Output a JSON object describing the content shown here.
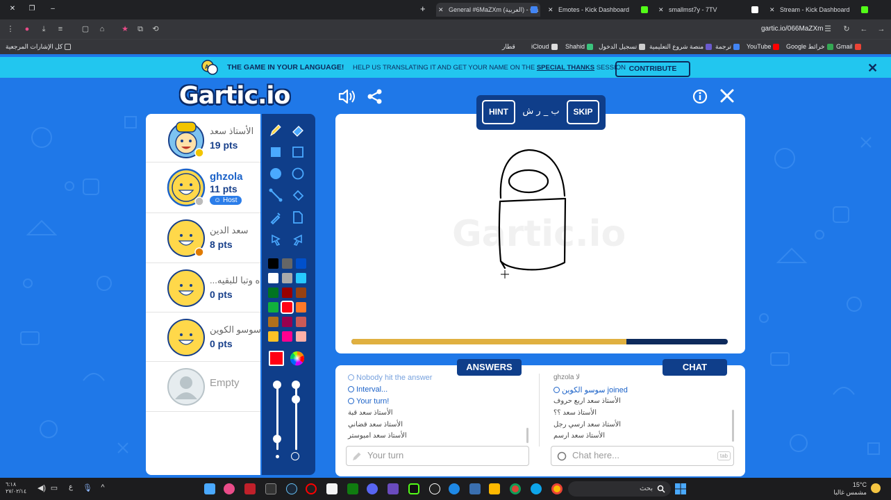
{
  "browser": {
    "tabs": [
      {
        "label": "General #6MaZXm (العربية) - Ga",
        "color": "#4285f4",
        "active": true
      },
      {
        "label": "Emotes - Kick Dashboard",
        "color": "#53fc18"
      },
      {
        "label": "smallmst7y - 7TV",
        "color": "#ffffff"
      },
      {
        "label": "Stream - Kick Dashboard",
        "color": "#53fc18"
      }
    ],
    "url": "gartic.io/066MaZXm",
    "bookmarks": [
      "Gmail",
      "Google خرائط",
      "YouTube",
      "ترجمة",
      "منصة شروع التعليمية",
      "تسجيل الدخول",
      "Shahid",
      "iCloud",
      "قطار",
      "كل الإشارات المرجعية"
    ]
  },
  "banner": {
    "headline": "THE GAME IN YOUR LANGUAGE!",
    "text_before": "HELP US TRANSLATING IT AND GET YOUR NAME ON THE",
    "link": "SPECIAL THANKS",
    "text_after": "SESSION",
    "button": "CONTRIBUTE"
  },
  "logo": "Gartic.io",
  "players": [
    {
      "name": "الأستاذ سعد",
      "points": "19 pts",
      "status_color": "#f2c500"
    },
    {
      "name": "ghzola",
      "points": "11 pts",
      "status_color": "#bbbbbb",
      "badge": "Host"
    },
    {
      "name": "سعد الدين",
      "points": "8 pts",
      "status_color": "#e07b00"
    },
    {
      "name": "...ه وتبا للبقيه",
      "points": "0 pts"
    },
    {
      "name": "سوسو الكوين",
      "points": "0 pts"
    }
  ],
  "empty_slot": "Empty",
  "palette": {
    "colors": [
      "#000000",
      "#666666",
      "#0050cc",
      "#ffffff",
      "#aaaaaa",
      "#26c9ff",
      "#017420",
      "#990000",
      "#964112",
      "#11b03c",
      "#ff0013",
      "#ff7829",
      "#b0701c",
      "#99004e",
      "#cb5a57",
      "#ffc126",
      "#ff008f",
      "#feafa8"
    ],
    "selected_color": "#ff0013"
  },
  "word_panel": {
    "hint": "HINT",
    "word": "ب _ ر ش",
    "skip": "SKIP"
  },
  "timer": {
    "progress": 0.73,
    "fill_color": "#e0b040"
  },
  "answers": {
    "tab": "ANSWERS",
    "messages": [
      {
        "text": "Nobody hit the answer",
        "type": "sys"
      },
      {
        "text": "Interval...",
        "type": "sys"
      },
      {
        "text": "Your turn!",
        "type": "sys"
      },
      {
        "text": "الأستاذ سعد قبة",
        "type": "msg"
      },
      {
        "text": "الأستاذ سعد قضاني",
        "type": "msg"
      },
      {
        "text": "الأستاذ سعد امبوستر",
        "type": "msg"
      }
    ],
    "placeholder": "Your turn"
  },
  "chat": {
    "tab": "CHAT",
    "messages": [
      {
        "text": "ghzola لا",
        "type": "msg"
      },
      {
        "text": "سوسو الكوين joined",
        "type": "sys"
      },
      {
        "text": "الأستاذ سعد اربع حروف",
        "type": "msg"
      },
      {
        "text": "الأستاذ سعد ؟؟",
        "type": "msg"
      },
      {
        "text": "الأستاذ سعد ارسي رجل",
        "type": "msg"
      },
      {
        "text": "الأستاذ سعد ارسم",
        "type": "msg"
      }
    ],
    "placeholder": "Chat here...",
    "tab_hint": "tab"
  },
  "taskbar": {
    "search": "بحث",
    "weather_temp": "15°C",
    "weather_text": "مشمس غالبا",
    "time": "٦:١٨",
    "date": "٢٧/٠٢/١٤"
  }
}
